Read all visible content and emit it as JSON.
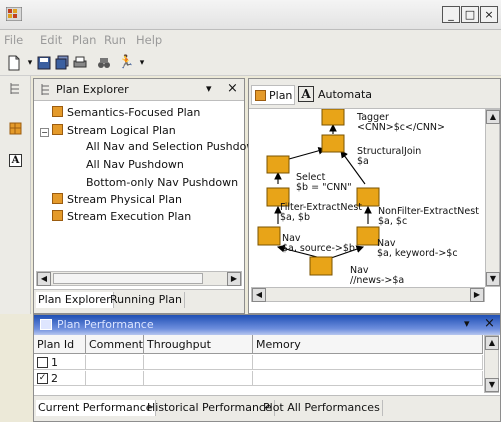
{
  "window": {
    "minimize": "_",
    "maximize": "□",
    "close": "×"
  },
  "menu": [
    "File",
    "Edit",
    "Plan",
    "Run",
    "Help"
  ],
  "explorer": {
    "title": "Plan Explorer",
    "dropdown": "▾",
    "close": "×",
    "tree": [
      {
        "label": "Semantics-Focused Plan",
        "level": 1,
        "icon": true
      },
      {
        "label": "Stream Logical Plan",
        "level": 1,
        "icon": true,
        "expander": "−"
      },
      {
        "label": "All Nav and Selection Pushdown",
        "level": 2,
        "icon": false
      },
      {
        "label": "All Nav Pushdown",
        "level": 2,
        "icon": false
      },
      {
        "label": "Bottom-only Nav Pushdown",
        "level": 2,
        "icon": false
      },
      {
        "label": "Stream Physical Plan",
        "level": 1,
        "icon": true
      },
      {
        "label": "Stream Execution Plan",
        "level": 1,
        "icon": true
      }
    ],
    "tabs": [
      "Plan Explorer",
      "Running Plan"
    ]
  },
  "plan": {
    "tabs": [
      "Plan",
      "Automata"
    ],
    "automata_glyph": "A",
    "operators": {
      "tagger": [
        "Tagger",
        "<CNN>$c</CNN>"
      ],
      "structural_join": [
        "StructuralJoin",
        "$a"
      ],
      "select": [
        "Select",
        "$b = \"CNN\""
      ],
      "filter_extract": [
        "Filter-ExtractNest",
        "$a, $b"
      ],
      "nonfilter_extract": [
        "NonFilter-ExtractNest",
        "$a, $c"
      ],
      "nav_left": [
        "Nav",
        "$a, source->$b"
      ],
      "nav_right": [
        "Nav",
        "$a, keyword->$c"
      ],
      "nav_bottom": [
        "Nav",
        "//news->$a"
      ]
    }
  },
  "perf": {
    "title": "Plan Performance",
    "dropdown": "▾",
    "close": "×",
    "columns": [
      "Plan Id",
      "Comment",
      "Throughput",
      "Memory"
    ],
    "rows": [
      {
        "id": "1",
        "checked": false
      },
      {
        "id": "2",
        "checked": true
      }
    ],
    "tabs": [
      "Current Performance",
      "Historical Performance",
      "Plot All Performances"
    ]
  },
  "colors": {
    "operator_fill": "#e8a418",
    "operator_border": "#7a5300",
    "perf_header": "#2a57be"
  }
}
